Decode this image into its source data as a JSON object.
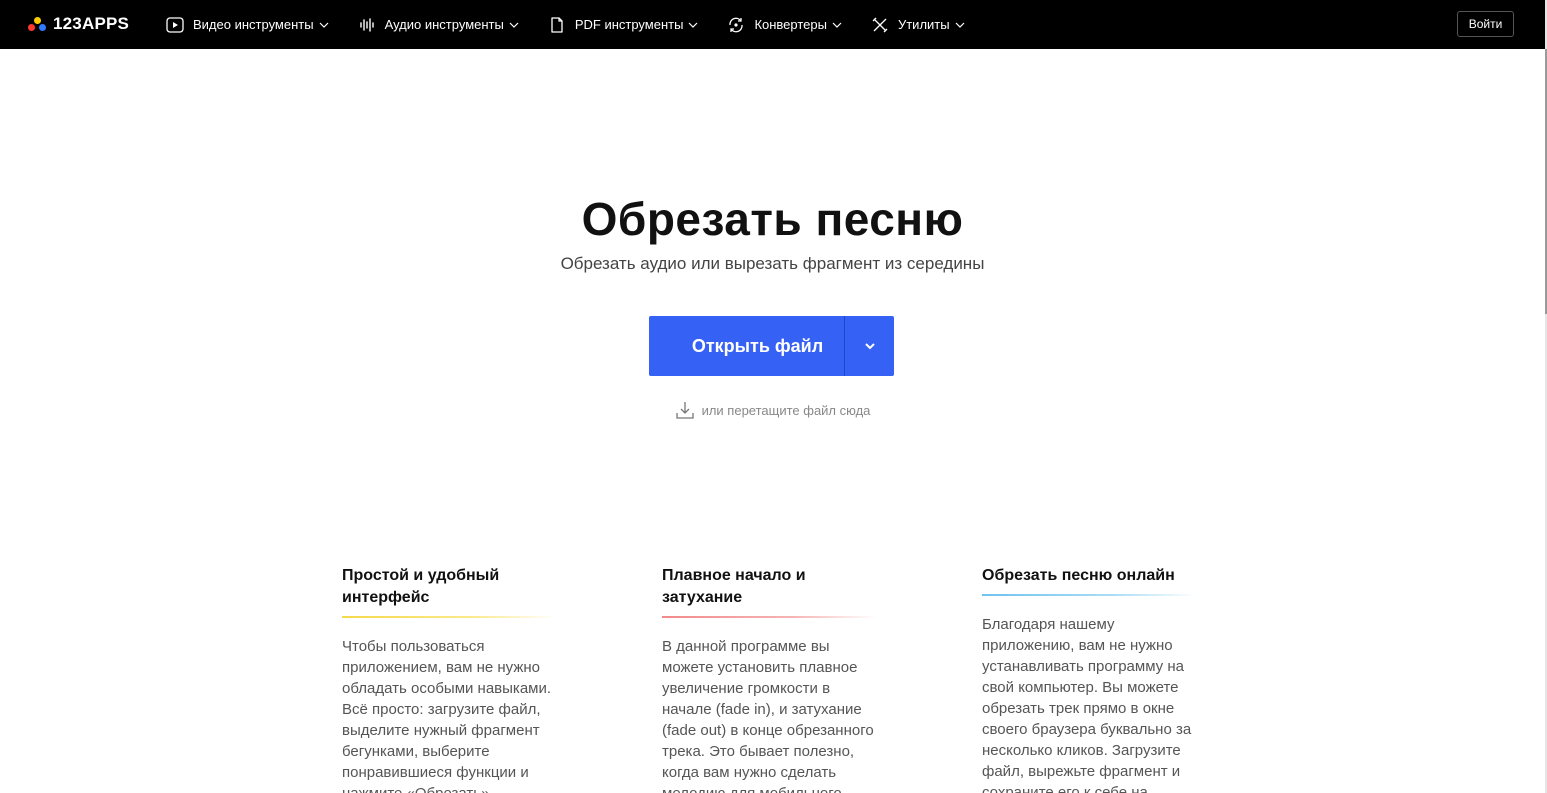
{
  "logo": {
    "text": "123APPS",
    "dot_colors": [
      "#ff3b30",
      "#ffcc00",
      "#2f7bff"
    ]
  },
  "nav": {
    "items": [
      {
        "label": "Видео инструменты",
        "icon": "video-play-icon"
      },
      {
        "label": "Аудио инструменты",
        "icon": "audio-wave-icon"
      },
      {
        "label": "PDF инструменты",
        "icon": "document-icon"
      },
      {
        "label": "Конвертеры",
        "icon": "convert-icon"
      },
      {
        "label": "Утилиты",
        "icon": "tools-icon"
      }
    ],
    "login_label": "Войти"
  },
  "hero": {
    "title": "Обрезать песню",
    "subtitle": "Обрезать аудио или вырезать фрагмент из середины",
    "open_button_label": "Открыть файл",
    "drag_hint": "или перетащите файл сюда"
  },
  "colors": {
    "accent": "#3561f4",
    "topbar": "#000000"
  },
  "features": [
    {
      "title": "Простой и удобный интерфейс",
      "text": "Чтобы пользоваться приложением, вам не нужно обладать особыми навыками. Всё просто: загрузите файл, выделите нужный фрагмент бегунками, выберите понравившиеся функции и нажмите «Обрезать».",
      "underline_color": "#f5d94a"
    },
    {
      "title": "Плавное начало и затухание",
      "text": "В данной программе вы можете установить плавное увеличение громкости в начале (fade in), и затухание (fade out) в конце обрезанного трека. Это бывает полезно, когда вам нужно сделать мелодию для мобильного",
      "underline_color": "#f28a8a"
    },
    {
      "title": "Обрезать песню онлайн",
      "text": "Благодаря нашему приложению, вам не нужно устанавливать программу на свой компьютер. Вы можете обрезать трек прямо в окне своего браузера буквально за несколько кликов. Загрузите файл, вырежьте фрагмент и сохраните его к себе на",
      "underline_color": "#6fc3f0"
    }
  ]
}
